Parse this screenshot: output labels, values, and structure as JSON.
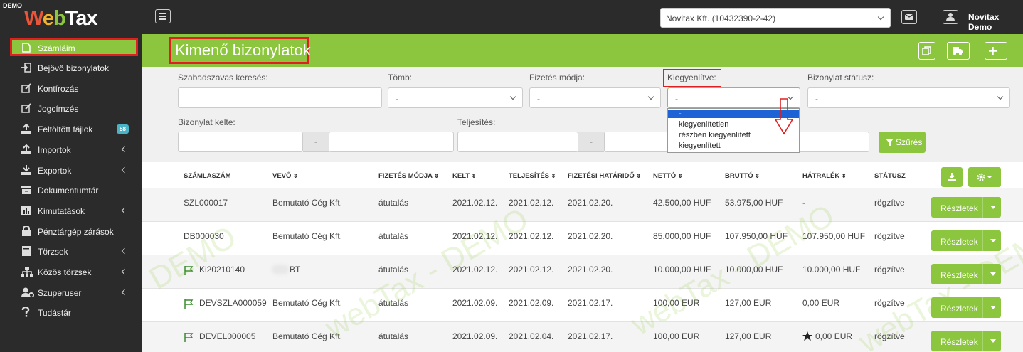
{
  "brand": {
    "demo": "DEMO",
    "logo_w": "W",
    "logo_e": "e",
    "logo_b": "b",
    "logo_tax": "Tax"
  },
  "topbar": {
    "company": "Novitax Kft. (10432390-2-42)",
    "user": "Novitax Demo"
  },
  "sidebar": {
    "active": {
      "label": "Számláim",
      "icon": "document-icon"
    },
    "items": [
      {
        "label": "Bejövő bizonylatok",
        "icon": "incoming-icon",
        "arrow": false
      },
      {
        "label": "Kontírozás",
        "icon": "edit-icon",
        "arrow": false
      },
      {
        "label": "Jogcímzés",
        "icon": "edit-icon",
        "arrow": false
      },
      {
        "label": "Feltöltött fájlok",
        "icon": "upload-icon",
        "arrow": false,
        "badge": "58"
      },
      {
        "label": "Importok",
        "icon": "upload-icon",
        "arrow": true
      },
      {
        "label": "Exportok",
        "icon": "download-icon",
        "arrow": true
      },
      {
        "label": "Dokumentumtár",
        "icon": "archive-icon",
        "arrow": false
      },
      {
        "label": "Kimutatások",
        "icon": "chart-icon",
        "arrow": true
      },
      {
        "label": "Pénztárgép zárások",
        "icon": "lock-icon",
        "arrow": false
      },
      {
        "label": "Törzsek",
        "icon": "book-icon",
        "arrow": true
      },
      {
        "label": "Közös törzsek",
        "icon": "sitemap-icon",
        "arrow": true
      },
      {
        "label": "Szuperuser",
        "icon": "users-gear-icon",
        "arrow": true
      },
      {
        "label": "Tudástár",
        "icon": "question-icon",
        "arrow": false
      }
    ]
  },
  "page": {
    "title": "Kimenő bizonylatok"
  },
  "filters": {
    "search_label": "Szabadszavas keresés:",
    "tomb_label": "Tömb:",
    "tomb_value": "-",
    "fizetes_label": "Fizetés módja:",
    "fizetes_value": "-",
    "kiegy_label": "Kiegyenlítve:",
    "kiegy_value": "-",
    "statusz_label": "Bizonylat státusz:",
    "statusz_value": "-",
    "kelte_label": "Bizonylat kelte:",
    "kelte_sep": "-",
    "teljesites_label": "Teljesítés:",
    "teljesites_sep": "-",
    "kiegy_options": [
      "-",
      "kiegyenlítetlen",
      "részben kiegyenlített",
      "kiegyenlített"
    ],
    "filter_button": "Szűrés"
  },
  "table": {
    "headers": {
      "szamlaszam": "SZÁMLASZÁM",
      "vevo": "VEVŐ",
      "fizetes": "FIZETÉS MÓDJA",
      "kelt": "KELT",
      "teljesites": "TELJESÍTÉS",
      "hatarido": "FIZETÉSI HATÁRIDŐ",
      "netto": "NETTÓ",
      "brutto": "BRUTTÓ",
      "hatralek": "HÁTRALÉK",
      "statusz": "STÁTUSZ",
      "sort": "⇕"
    },
    "details_label": "Részletek",
    "rows": [
      {
        "flag": false,
        "star": false,
        "szamlaszam": "SZL000017",
        "vevo": "Bemutató Cég Kft.",
        "fizetes": "átutalás",
        "kelt": "2021.02.12.",
        "teljesites": "2021.02.12.",
        "hatarido": "2021.02.20.",
        "netto": "42.500,00 HUF",
        "brutto": "53.975,00 HUF",
        "hatralek": "-",
        "statusz": "rögzítve"
      },
      {
        "flag": false,
        "star": false,
        "szamlaszam": "DB000030",
        "vevo": "Bemutató Cég Kft.",
        "fizetes": "átutalás",
        "kelt": "2021.02.12.",
        "teljesites": "2021.02.12.",
        "hatarido": "2021.02.20.",
        "netto": "85.000,00 HUF",
        "brutto": "107.950,00 HUF",
        "hatralek": "107.950,00 HUF",
        "statusz": "rögzítve"
      },
      {
        "flag": true,
        "star": false,
        "szamlaszam": "Ki20210140",
        "vevo": "BT",
        "fizetes": "átutalás",
        "kelt": "2021.02.12.",
        "teljesites": "2021.02.12.",
        "hatarido": "2021.02.20.",
        "netto": "10.000,00 HUF",
        "brutto": "10.000,00 HUF",
        "hatralek": "10.000,00 HUF",
        "statusz": "rögzítve"
      },
      {
        "flag": true,
        "star": false,
        "szamlaszam": "DEVSZLA000059",
        "vevo": "Bemutató Cég Kft.",
        "fizetes": "átutalás",
        "kelt": "2021.02.09.",
        "teljesites": "2021.02.09.",
        "hatarido": "2021.02.17.",
        "netto": "100,00 EUR",
        "brutto": "127,00 EUR",
        "hatralek": "0,00 EUR",
        "statusz": "rögzítve"
      },
      {
        "flag": true,
        "star": true,
        "szamlaszam": "DEVEL000005",
        "vevo": "Bemutató Cég Kft.",
        "fizetes": "átutalás",
        "kelt": "2021.02.09.",
        "teljesites": "2021.02.04.",
        "hatarido": "2021.02.17.",
        "netto": "100,00 EUR",
        "brutto": "127,00 EUR",
        "hatralek": "0,00 EUR",
        "statusz": "rögzítve"
      }
    ]
  },
  "watermark": {
    "a": "DEMO",
    "b": "webTax - DEMO",
    "c": "webTax - DEMO",
    "d": "webTax - DEMO"
  },
  "colors": {
    "brand_green": "#8cc63e",
    "sidebar_bg": "#2b2b2b",
    "highlight_red": "#e02020",
    "badge": "#4ab3c8"
  }
}
